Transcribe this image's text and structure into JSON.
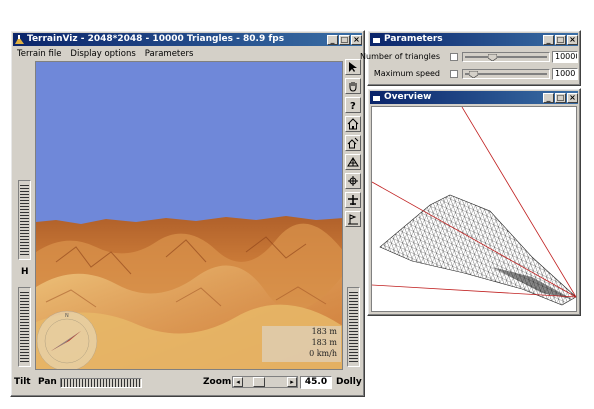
{
  "main_window": {
    "title": "TerrainViz - 2048*2048 - 10000 Triangles - 80.9 fps",
    "menu": [
      "Terrain file",
      "Display options",
      "Parameters"
    ],
    "caption_buttons": [
      "_",
      "□",
      "×"
    ]
  },
  "readout": {
    "line1": "183 m",
    "line2": "183 m",
    "line3": "0 km/h"
  },
  "labels": {
    "h": "H",
    "tilt": "Tilt",
    "pan": "Pan",
    "zoom": "Zoom",
    "dolly": "Dolly",
    "zoom_value": "45.0"
  },
  "toolbar_icons": [
    "select-arrow-icon",
    "hand-pan-icon",
    "help-question-icon",
    "home-icon",
    "home-set-icon",
    "terrain-grid-icon",
    "move-cross-icon",
    "airplane-icon",
    "rotate-flag-icon"
  ],
  "parameters_window": {
    "title": "Parameters",
    "rows": [
      {
        "label": "Number of triangles",
        "value": "10000",
        "fraction": 0.31
      },
      {
        "label": "Maximum speed",
        "value": "1000",
        "fraction": 0.08
      }
    ]
  },
  "overview_window": {
    "title": "Overview"
  },
  "colors": {
    "titlebar_start": "#0a246a",
    "titlebar_end": "#3a6ea5",
    "sky": "#6f88d9",
    "terrain": "#d98b3a",
    "window_face": "#d4d0c8",
    "view_lines": "#c02020"
  }
}
